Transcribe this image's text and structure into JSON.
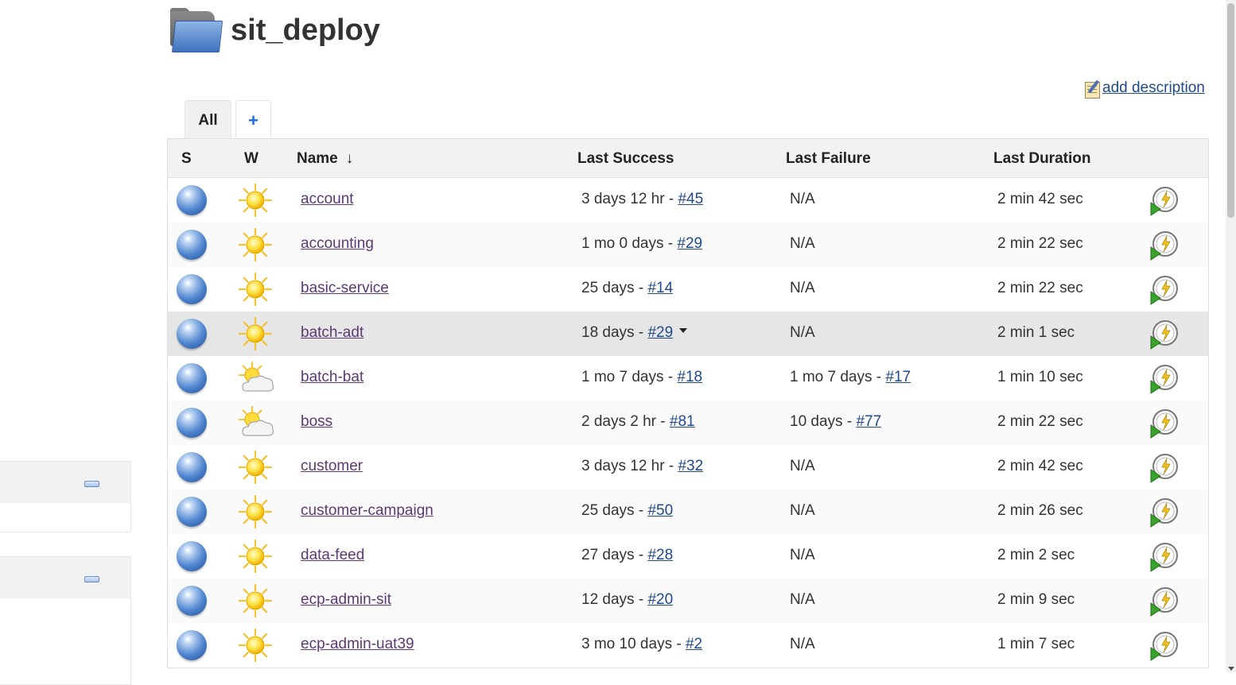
{
  "page": {
    "title": "sit_deploy",
    "add_description": "add description"
  },
  "tabs": [
    {
      "label": "All",
      "active": true
    },
    {
      "label": "+",
      "active": false
    }
  ],
  "columns": {
    "status": "S",
    "weather": "W",
    "name": "Name",
    "sort_indicator": "↓",
    "last_success": "Last Success",
    "last_failure": "Last Failure",
    "last_duration": "Last Duration"
  },
  "jobs": [
    {
      "name": "account",
      "weather": "sunny",
      "success_ago": "3 days 12 hr - ",
      "success_build": "#45",
      "failure_ago": "N/A",
      "failure_build": "",
      "duration": "2 min 42 sec"
    },
    {
      "name": "accounting",
      "weather": "sunny",
      "success_ago": "1 mo 0 days - ",
      "success_build": "#29",
      "failure_ago": "N/A",
      "failure_build": "",
      "duration": "2 min 22 sec"
    },
    {
      "name": "basic-service",
      "weather": "sunny",
      "success_ago": "25 days - ",
      "success_build": "#14",
      "failure_ago": "N/A",
      "failure_build": "",
      "duration": "2 min 22 sec"
    },
    {
      "name": "batch-adt",
      "weather": "sunny",
      "success_ago": "18 days - ",
      "success_build": "#29",
      "failure_ago": "N/A",
      "failure_build": "",
      "duration": "2 min 1 sec"
    },
    {
      "name": "batch-bat",
      "weather": "partly-cloudy",
      "success_ago": "1 mo 7 days - ",
      "success_build": "#18",
      "failure_ago": "1 mo 7 days - ",
      "failure_build": "#17",
      "duration": "1 min 10 sec"
    },
    {
      "name": "boss",
      "weather": "partly-cloudy",
      "success_ago": "2 days 2 hr - ",
      "success_build": "#81",
      "failure_ago": "10 days - ",
      "failure_build": "#77",
      "duration": "2 min 22 sec"
    },
    {
      "name": "customer",
      "weather": "sunny",
      "success_ago": "3 days 12 hr - ",
      "success_build": "#32",
      "failure_ago": "N/A",
      "failure_build": "",
      "duration": "2 min 42 sec"
    },
    {
      "name": "customer-campaign",
      "weather": "sunny",
      "success_ago": "25 days - ",
      "success_build": "#50",
      "failure_ago": "N/A",
      "failure_build": "",
      "duration": "2 min 26 sec"
    },
    {
      "name": "data-feed",
      "weather": "sunny",
      "success_ago": "27 days - ",
      "success_build": "#28",
      "failure_ago": "N/A",
      "failure_build": "",
      "duration": "2 min 2 sec"
    },
    {
      "name": "ecp-admin-sit",
      "weather": "sunny",
      "success_ago": "12 days - ",
      "success_build": "#20",
      "failure_ago": "N/A",
      "failure_build": "",
      "duration": "2 min 9 sec"
    },
    {
      "name": "ecp-admin-uat39",
      "weather": "sunny",
      "success_ago": "3 mo 10 days - ",
      "success_build": "#2",
      "failure_ago": "N/A",
      "failure_build": "",
      "duration": "1 min 7 sec"
    }
  ]
}
